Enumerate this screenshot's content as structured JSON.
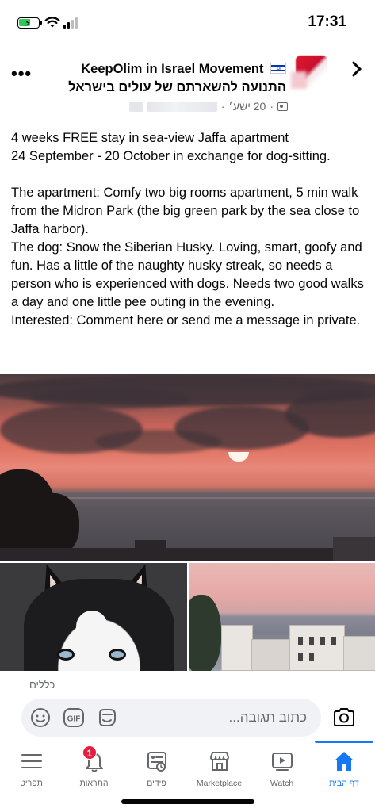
{
  "status_bar": {
    "time": "17:31",
    "battery_level": 0.6
  },
  "post": {
    "group_name": "KeepOlim in Israel Movement",
    "group_subtitle": "התנועה להשארתם של עולים בישראל",
    "timestamp": "20 ישע׳",
    "lines": [
      "4 weeks FREE stay in sea-view Jaffa apartment",
      "24 September - 20 October in exchange for dog-sitting.",
      "",
      "The apartment: Comfy two big rooms apartment, 5 min walk from the Midron Park (the big green park by the sea close to Jaffa harbor).",
      "The dog: Snow the Siberian Husky. Loving, smart, goofy and fun. Has a little of the naughty husky streak, so needs a person who is experienced with dogs. Needs two good walks a day and one little pee outing in the evening.",
      "Interested: Comment here or send me a message in private."
    ]
  },
  "reactions": {
    "label": "כללים"
  },
  "comment": {
    "placeholder": "כתוב תגובה..."
  },
  "tabs": [
    {
      "label": "תפריט",
      "icon": "menu-icon",
      "active": false
    },
    {
      "label": "התראות",
      "icon": "bell-icon",
      "active": false,
      "badge": "1"
    },
    {
      "label": "פידים",
      "icon": "feeds-icon",
      "active": false
    },
    {
      "label": "Marketplace",
      "icon": "marketplace-icon",
      "active": false
    },
    {
      "label": "Watch",
      "icon": "watch-icon",
      "active": false
    },
    {
      "label": "דף הבית",
      "icon": "home-icon",
      "active": true
    }
  ],
  "colors": {
    "accent": "#1877f2",
    "badge": "#e41e3f",
    "secondary_text": "#65676b"
  }
}
